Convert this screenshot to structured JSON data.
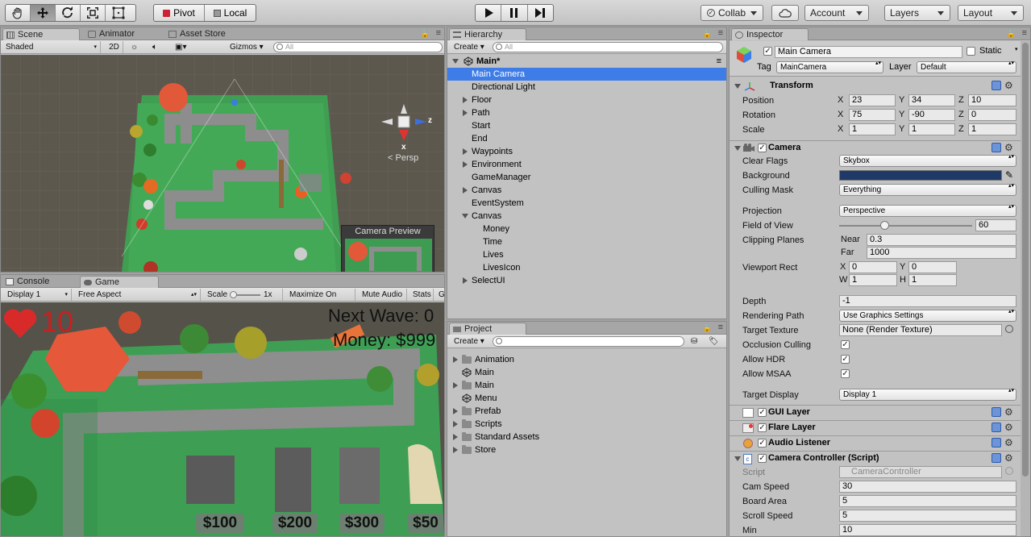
{
  "toolbar": {
    "tools": [
      "hand-tool",
      "move-tool",
      "rotate-tool",
      "scale-tool",
      "rect-tool"
    ],
    "pivot": "Pivot",
    "local": "Local",
    "collab": "Collab",
    "account": "Account",
    "layers": "Layers",
    "layout": "Layout"
  },
  "scene": {
    "tabs": [
      "Scene",
      "Animator",
      "Asset Store"
    ],
    "shading": "Shaded",
    "mode2d": "2D",
    "gizmos": "Gizmos",
    "search_placeholder": "All",
    "persp": "Persp",
    "axis_x": "x",
    "axis_z": "z",
    "camera_preview": "Camera Preview"
  },
  "game": {
    "tabs": [
      "Console",
      "Game"
    ],
    "display": "Display 1",
    "aspect": "Free Aspect",
    "scale_label": "Scale",
    "scale_value": "1x",
    "maximize": "Maximize On Play",
    "mute": "Mute Audio",
    "stats": "Stats",
    "gizmos_cut": "G",
    "hud_lives": "10",
    "hud_wave": "Next Wave: 0",
    "hud_money": "Money: $999",
    "prices": [
      "$100",
      "$200",
      "$300",
      "$50"
    ]
  },
  "hierarchy": {
    "title": "Hierarchy",
    "create": "Create",
    "search_placeholder": "All",
    "scene_name": "Main*",
    "items": [
      {
        "label": "Main Camera",
        "depth": 1,
        "arrow": "",
        "selected": true
      },
      {
        "label": "Directional Light",
        "depth": 1,
        "arrow": ""
      },
      {
        "label": "Floor",
        "depth": 1,
        "arrow": "r"
      },
      {
        "label": "Path",
        "depth": 1,
        "arrow": "r"
      },
      {
        "label": "Start",
        "depth": 1,
        "arrow": ""
      },
      {
        "label": "End",
        "depth": 1,
        "arrow": ""
      },
      {
        "label": "Waypoints",
        "depth": 1,
        "arrow": "r"
      },
      {
        "label": "Environment",
        "depth": 1,
        "arrow": "r"
      },
      {
        "label": "GameManager",
        "depth": 1,
        "arrow": ""
      },
      {
        "label": "Canvas",
        "depth": 1,
        "arrow": "r"
      },
      {
        "label": "EventSystem",
        "depth": 1,
        "arrow": ""
      },
      {
        "label": "Canvas",
        "depth": 1,
        "arrow": "d"
      },
      {
        "label": "Money",
        "depth": 2,
        "arrow": ""
      },
      {
        "label": "Time",
        "depth": 2,
        "arrow": ""
      },
      {
        "label": "Lives",
        "depth": 2,
        "arrow": ""
      },
      {
        "label": "LivesIcon",
        "depth": 2,
        "arrow": ""
      },
      {
        "label": "SelectUI",
        "depth": 1,
        "arrow": "r"
      }
    ]
  },
  "project": {
    "title": "Project",
    "create": "Create",
    "items": [
      {
        "label": "Animation",
        "icon": "folder",
        "arrow": true
      },
      {
        "label": "Main",
        "icon": "unity",
        "arrow": false
      },
      {
        "label": "Main",
        "icon": "folder",
        "arrow": true
      },
      {
        "label": "Menu",
        "icon": "unity",
        "arrow": false
      },
      {
        "label": "Prefab",
        "icon": "folder",
        "arrow": true
      },
      {
        "label": "Scripts",
        "icon": "folder",
        "arrow": true
      },
      {
        "label": "Standard Assets",
        "icon": "folder",
        "arrow": true
      },
      {
        "label": "Store",
        "icon": "folder",
        "arrow": true
      }
    ]
  },
  "inspector": {
    "title": "Inspector",
    "object_name": "Main Camera",
    "static": "Static",
    "tag_label": "Tag",
    "tag": "MainCamera",
    "layer_label": "Layer",
    "layer": "Default",
    "transform": {
      "title": "Transform",
      "position_label": "Position",
      "position": {
        "x": "23",
        "y": "34",
        "z": "10"
      },
      "rotation_label": "Rotation",
      "rotation": {
        "x": "75",
        "y": "-90",
        "z": "0"
      },
      "scale_label": "Scale",
      "scale": {
        "x": "1",
        "y": "1",
        "z": "1"
      }
    },
    "camera": {
      "title": "Camera",
      "clear_flags_label": "Clear Flags",
      "clear_flags": "Skybox",
      "background_label": "Background",
      "background_color": "#1f3a66",
      "culling_mask_label": "Culling Mask",
      "culling_mask": "Everything",
      "projection_label": "Projection",
      "projection": "Perspective",
      "fov_label": "Field of View",
      "fov": "60",
      "clipping_label": "Clipping Planes",
      "near_label": "Near",
      "near": "0.3",
      "far_label": "Far",
      "far": "1000",
      "viewport_label": "Viewport Rect",
      "vx": "0",
      "vy": "0",
      "vw": "1",
      "vh": "1",
      "depth_label": "Depth",
      "depth": "-1",
      "rendering_path_label": "Rendering Path",
      "rendering_path": "Use Graphics Settings",
      "target_texture_label": "Target Texture",
      "target_texture": "None (Render Texture)",
      "occlusion_label": "Occlusion Culling",
      "hdr_label": "Allow HDR",
      "msaa_label": "Allow MSAA",
      "target_display_label": "Target Display",
      "target_display": "Display 1"
    },
    "gui_layer": "GUI Layer",
    "flare_layer": "Flare Layer",
    "audio_listener": "Audio Listener",
    "camera_controller": {
      "title": "Camera Controller (Script)",
      "script_label": "Script",
      "script": "CameraController",
      "cam_speed_label": "Cam Speed",
      "cam_speed": "30",
      "board_area_label": "Board Area",
      "board_area": "5",
      "scroll_speed_label": "Scroll Speed",
      "scroll_speed": "5",
      "min_label": "Min",
      "min": "10"
    }
  }
}
